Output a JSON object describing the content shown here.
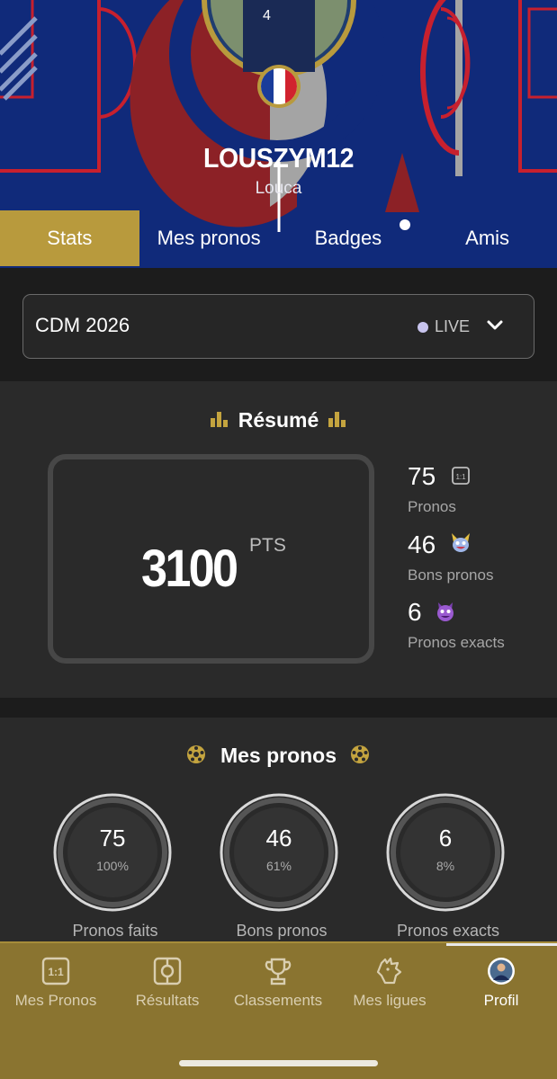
{
  "profile": {
    "username": "LOUSZYM12",
    "real_name": "Louca",
    "flag": "france-flag"
  },
  "tabs": [
    {
      "label": "Stats",
      "active": true
    },
    {
      "label": "Mes pronos",
      "active": false
    },
    {
      "label": "Badges",
      "active": false
    },
    {
      "label": "Amis",
      "active": false
    }
  ],
  "competition": {
    "selected": "CDM 2026",
    "status": "LIVE"
  },
  "resume": {
    "title": "Résumé",
    "points_value": "3100",
    "points_unit": "PTS",
    "stats": [
      {
        "value": "75",
        "label": "Pronos",
        "icon": "score-1-1-icon"
      },
      {
        "value": "46",
        "label": "Bons pronos",
        "icon": "happy-monster-icon"
      },
      {
        "value": "6",
        "label": "Pronos exacts",
        "icon": "purple-monster-icon"
      }
    ]
  },
  "mes_pronos": {
    "title": "Mes pronos",
    "rings": [
      {
        "value": "75",
        "percent": "100%",
        "label": "Pronos faits"
      },
      {
        "value": "46",
        "percent": "61%",
        "label": "Bons pronos"
      },
      {
        "value": "6",
        "percent": "8%",
        "label": "Pronos exacts"
      }
    ]
  },
  "bottom_nav": [
    {
      "label": "Mes Pronos",
      "icon": "score-1-1-icon",
      "active": false
    },
    {
      "label": "Résultats",
      "icon": "whistle-icon",
      "active": false
    },
    {
      "label": "Classements",
      "icon": "trophy-icon",
      "active": false
    },
    {
      "label": "Mes ligues",
      "icon": "rooster-icon",
      "active": false
    },
    {
      "label": "Profil",
      "icon": "avatar-icon",
      "active": true
    }
  ],
  "colors": {
    "header_blue": "#102a7a",
    "gold_accent": "#b89a3d",
    "nav_gold": "#8a7430",
    "dark_bg": "#1c1c1c",
    "card_bg": "#2a2a2a"
  }
}
